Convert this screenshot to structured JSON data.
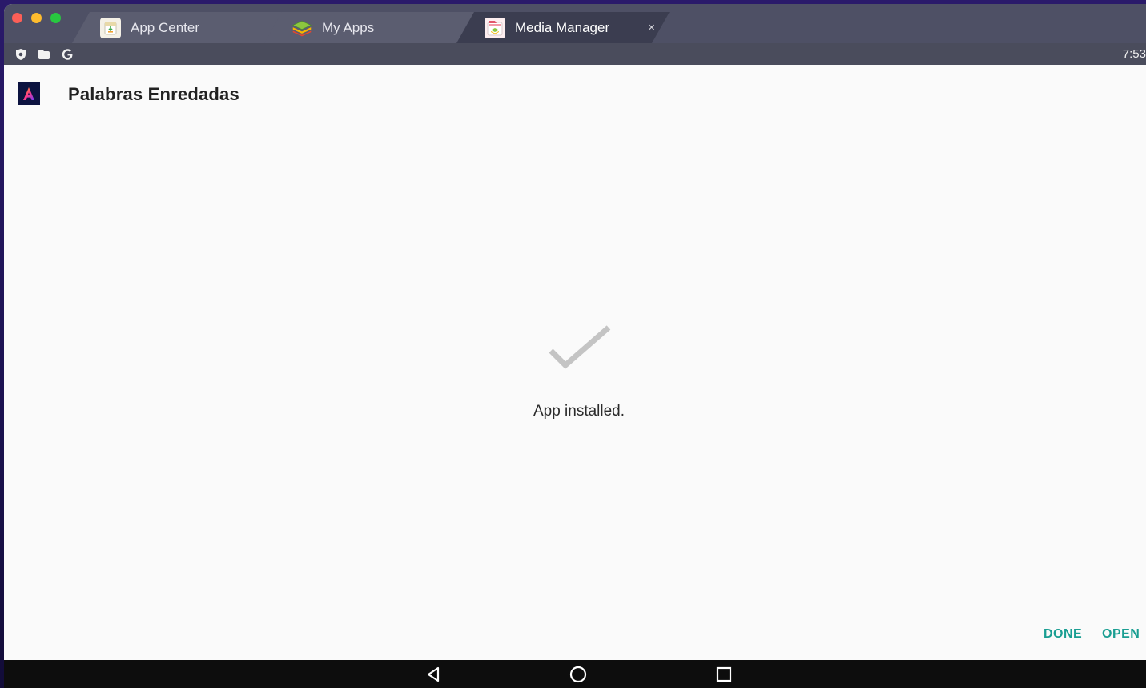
{
  "window": {
    "tabs": [
      {
        "label": "App Center",
        "icon": "app-center-icon",
        "active": false
      },
      {
        "label": "My Apps",
        "icon": "my-apps-icon",
        "active": false
      },
      {
        "label": "Media Manager",
        "icon": "media-manager-icon",
        "active": true,
        "close_label": "×"
      }
    ]
  },
  "statusbar": {
    "icons": [
      "shield-icon",
      "folder-icon",
      "google-icon"
    ],
    "clock": "7:53"
  },
  "app": {
    "name": "Palabras Enredadas",
    "icon": "app-logo-icon",
    "status_text": "App installed."
  },
  "actions": {
    "done_label": "DONE",
    "open_label": "OPEN"
  },
  "navbar": {
    "icons": [
      "back-icon",
      "home-icon",
      "recents-icon"
    ]
  },
  "colors": {
    "accent": "#1a9e92",
    "titlebar": "#4e5065",
    "statusbar": "#4a4c5c",
    "navbar": "#0d0d0d",
    "content_bg": "#fafafa"
  }
}
